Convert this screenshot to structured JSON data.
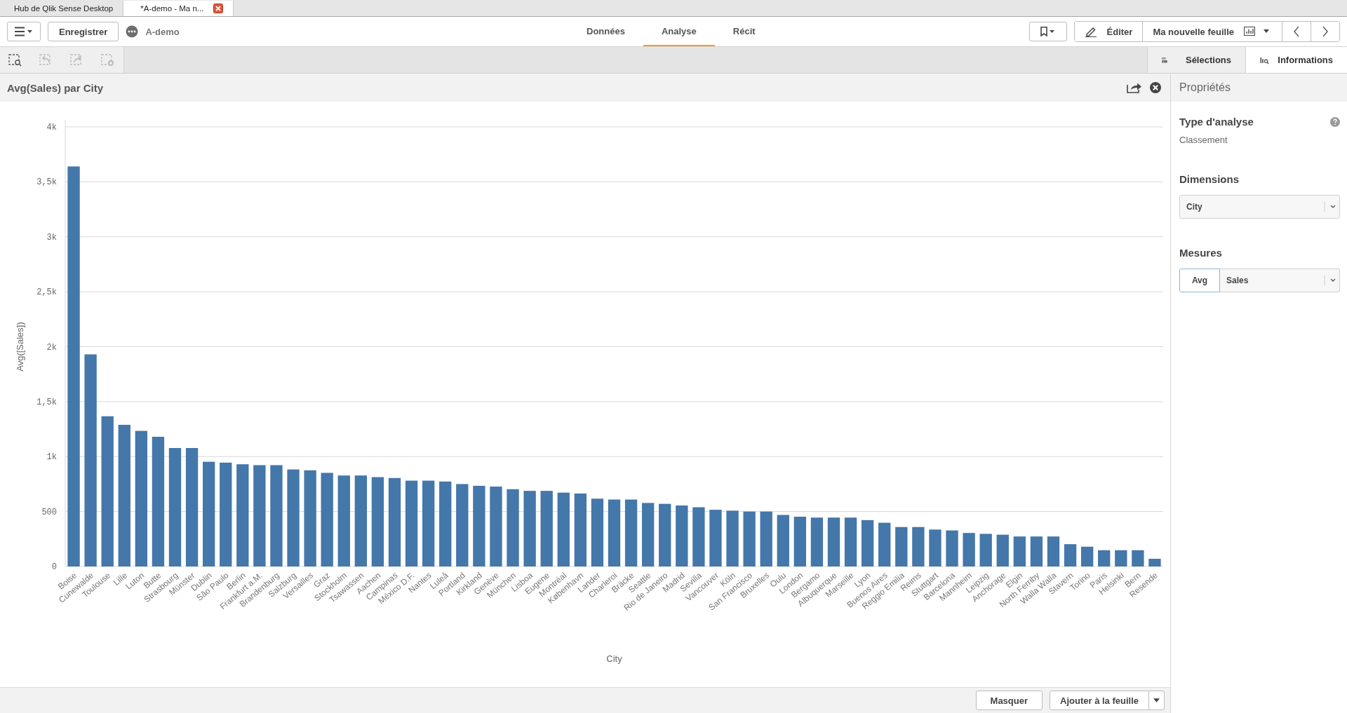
{
  "browser_tabs": [
    {
      "label": "Hub de Qlik Sense Desktop",
      "selected": false
    },
    {
      "label": "*A-demo - Ma n...",
      "selected": true
    }
  ],
  "toolbar": {
    "save_label": "Enregistrer",
    "app_name": "A-demo",
    "nav_tabs": [
      {
        "label": "Données",
        "selected": false
      },
      {
        "label": "Analyse",
        "selected": true
      },
      {
        "label": "Récit",
        "selected": false
      }
    ],
    "edit_label": "Éditer",
    "sheet_label": "Ma nouvelle feuille"
  },
  "selection_tools": [
    {
      "kind": "lasso",
      "disabled": false
    },
    {
      "kind": "back",
      "disabled": true
    },
    {
      "kind": "forward",
      "disabled": true
    },
    {
      "kind": "clear",
      "disabled": true
    }
  ],
  "panel_tabs": [
    {
      "label": "Sélections",
      "selected": false
    },
    {
      "label": "Informations",
      "selected": true
    }
  ],
  "chart": {
    "chart_data": {
      "type": "bar",
      "title": "Avg(Sales) par City",
      "xlabel": "City",
      "ylabel": "Avg([Sales])",
      "categories": [
        "Boise",
        "Cunewalde",
        "Toulouse",
        "Lille",
        "Luton",
        "Butte",
        "Strasbourg",
        "Münster",
        "Dublin",
        "São Paulo",
        "Berlin",
        "Frankfurt a.M.",
        "Brandenburg",
        "Salzburg",
        "Versailles",
        "Graz",
        "Stockholm",
        "Tsawassen",
        "Aachen",
        "Campinas",
        "México D.F.",
        "Nantes",
        "Luleå",
        "Portland",
        "Kirkland",
        "Genève",
        "München",
        "Lisboa",
        "Eugene",
        "Montréal",
        "København",
        "Lander",
        "Charleroi",
        "Bräcke",
        "Seattle",
        "Rio de Janeiro",
        "Madrid",
        "Sevilla",
        "Vancouver",
        "Köln",
        "San Francisco",
        "Bruxelles",
        "Oulu",
        "London",
        "Bergamo",
        "Albuquerque",
        "Marseille",
        "Lyon",
        "Buenos Aires",
        "Reggio Emilia",
        "Reims",
        "Stuttgart",
        "Barcelona",
        "Mannheim",
        "Leipzig",
        "Anchorage",
        "Elgin",
        "North Ferriby",
        "Walla Walla",
        "Stavern",
        "Torino",
        "Paris",
        "Helsinki",
        "Bern",
        "Resende"
      ],
      "values": [
        3640,
        1930,
        1367,
        1289,
        1234,
        1180,
        1078,
        1078,
        953,
        945,
        930,
        922,
        922,
        883,
        875,
        852,
        828,
        828,
        813,
        805,
        781,
        781,
        773,
        750,
        734,
        727,
        703,
        688,
        688,
        672,
        664,
        617,
        609,
        609,
        578,
        570,
        555,
        539,
        516,
        508,
        500,
        500,
        469,
        453,
        445,
        445,
        445,
        422,
        398,
        359,
        359,
        336,
        328,
        305,
        297,
        289,
        273,
        273,
        273,
        203,
        180,
        148,
        148,
        148,
        70
      ],
      "ylim": [
        0,
        4000
      ],
      "grid": true,
      "yticks": [
        {
          "value": 0,
          "label": "0"
        },
        {
          "value": 500,
          "label": "500"
        },
        {
          "value": 1000,
          "label": "1k"
        },
        {
          "value": 1500,
          "label": "1,5k"
        },
        {
          "value": 2000,
          "label": "2k"
        },
        {
          "value": 2500,
          "label": "2,5k"
        },
        {
          "value": 3000,
          "label": "3k"
        },
        {
          "value": 3500,
          "label": "3,5k"
        },
        {
          "value": 4000,
          "label": "4k"
        }
      ]
    }
  },
  "properties": {
    "title": "Propriétés",
    "analysis_heading": "Type d'analyse",
    "analysis_value": "Classement",
    "dimensions_heading": "Dimensions",
    "dimension": "City",
    "measures_heading": "Mesures",
    "aggregation": "Avg",
    "measure": "Sales"
  },
  "footer_buttons": [
    "Masquer",
    "Ajouter à la feuille"
  ]
}
